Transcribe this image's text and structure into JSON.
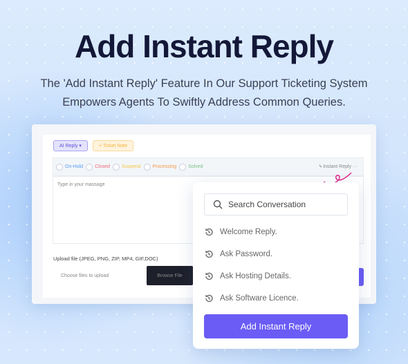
{
  "hero": {
    "title": "Add Instant Reply",
    "subtitle_line1": "The 'Add Instant Reply' Feature In Our Support Ticketing System",
    "subtitle_line2": "Empowers Agents To Swiftly Address Common Queries."
  },
  "editor": {
    "ai_reply": "AI Reply ▾",
    "ticket_note": "+ Ticket Note",
    "statuses": [
      {
        "label": "On-Hold",
        "color": "#5b9bf0"
      },
      {
        "label": "Closed",
        "color": "#f06a7a"
      },
      {
        "label": "Suspend",
        "color": "#f5c84a"
      },
      {
        "label": "Processing",
        "color": "#f39a4a"
      },
      {
        "label": "Solved",
        "color": "#7bbf8a"
      }
    ],
    "instant_reply": "Instant Reply ···",
    "message_placeholder": "Type in your massage",
    "upload_label": "Upload file (JPEG, PNG, ZIP, MP4, GIF,DOC)",
    "choose_files": "Choose files to upload",
    "browse": "Browse File"
  },
  "popup": {
    "search_placeholder": "Search Conversation",
    "items": [
      "Welcome Reply.",
      "Ask Password.",
      "Ask Hosting Details.",
      "Ask Software Licence."
    ],
    "add_button": "Add Instant Reply"
  },
  "colors": {
    "accent": "#6a5cf5",
    "arrow": "#e0288a"
  }
}
